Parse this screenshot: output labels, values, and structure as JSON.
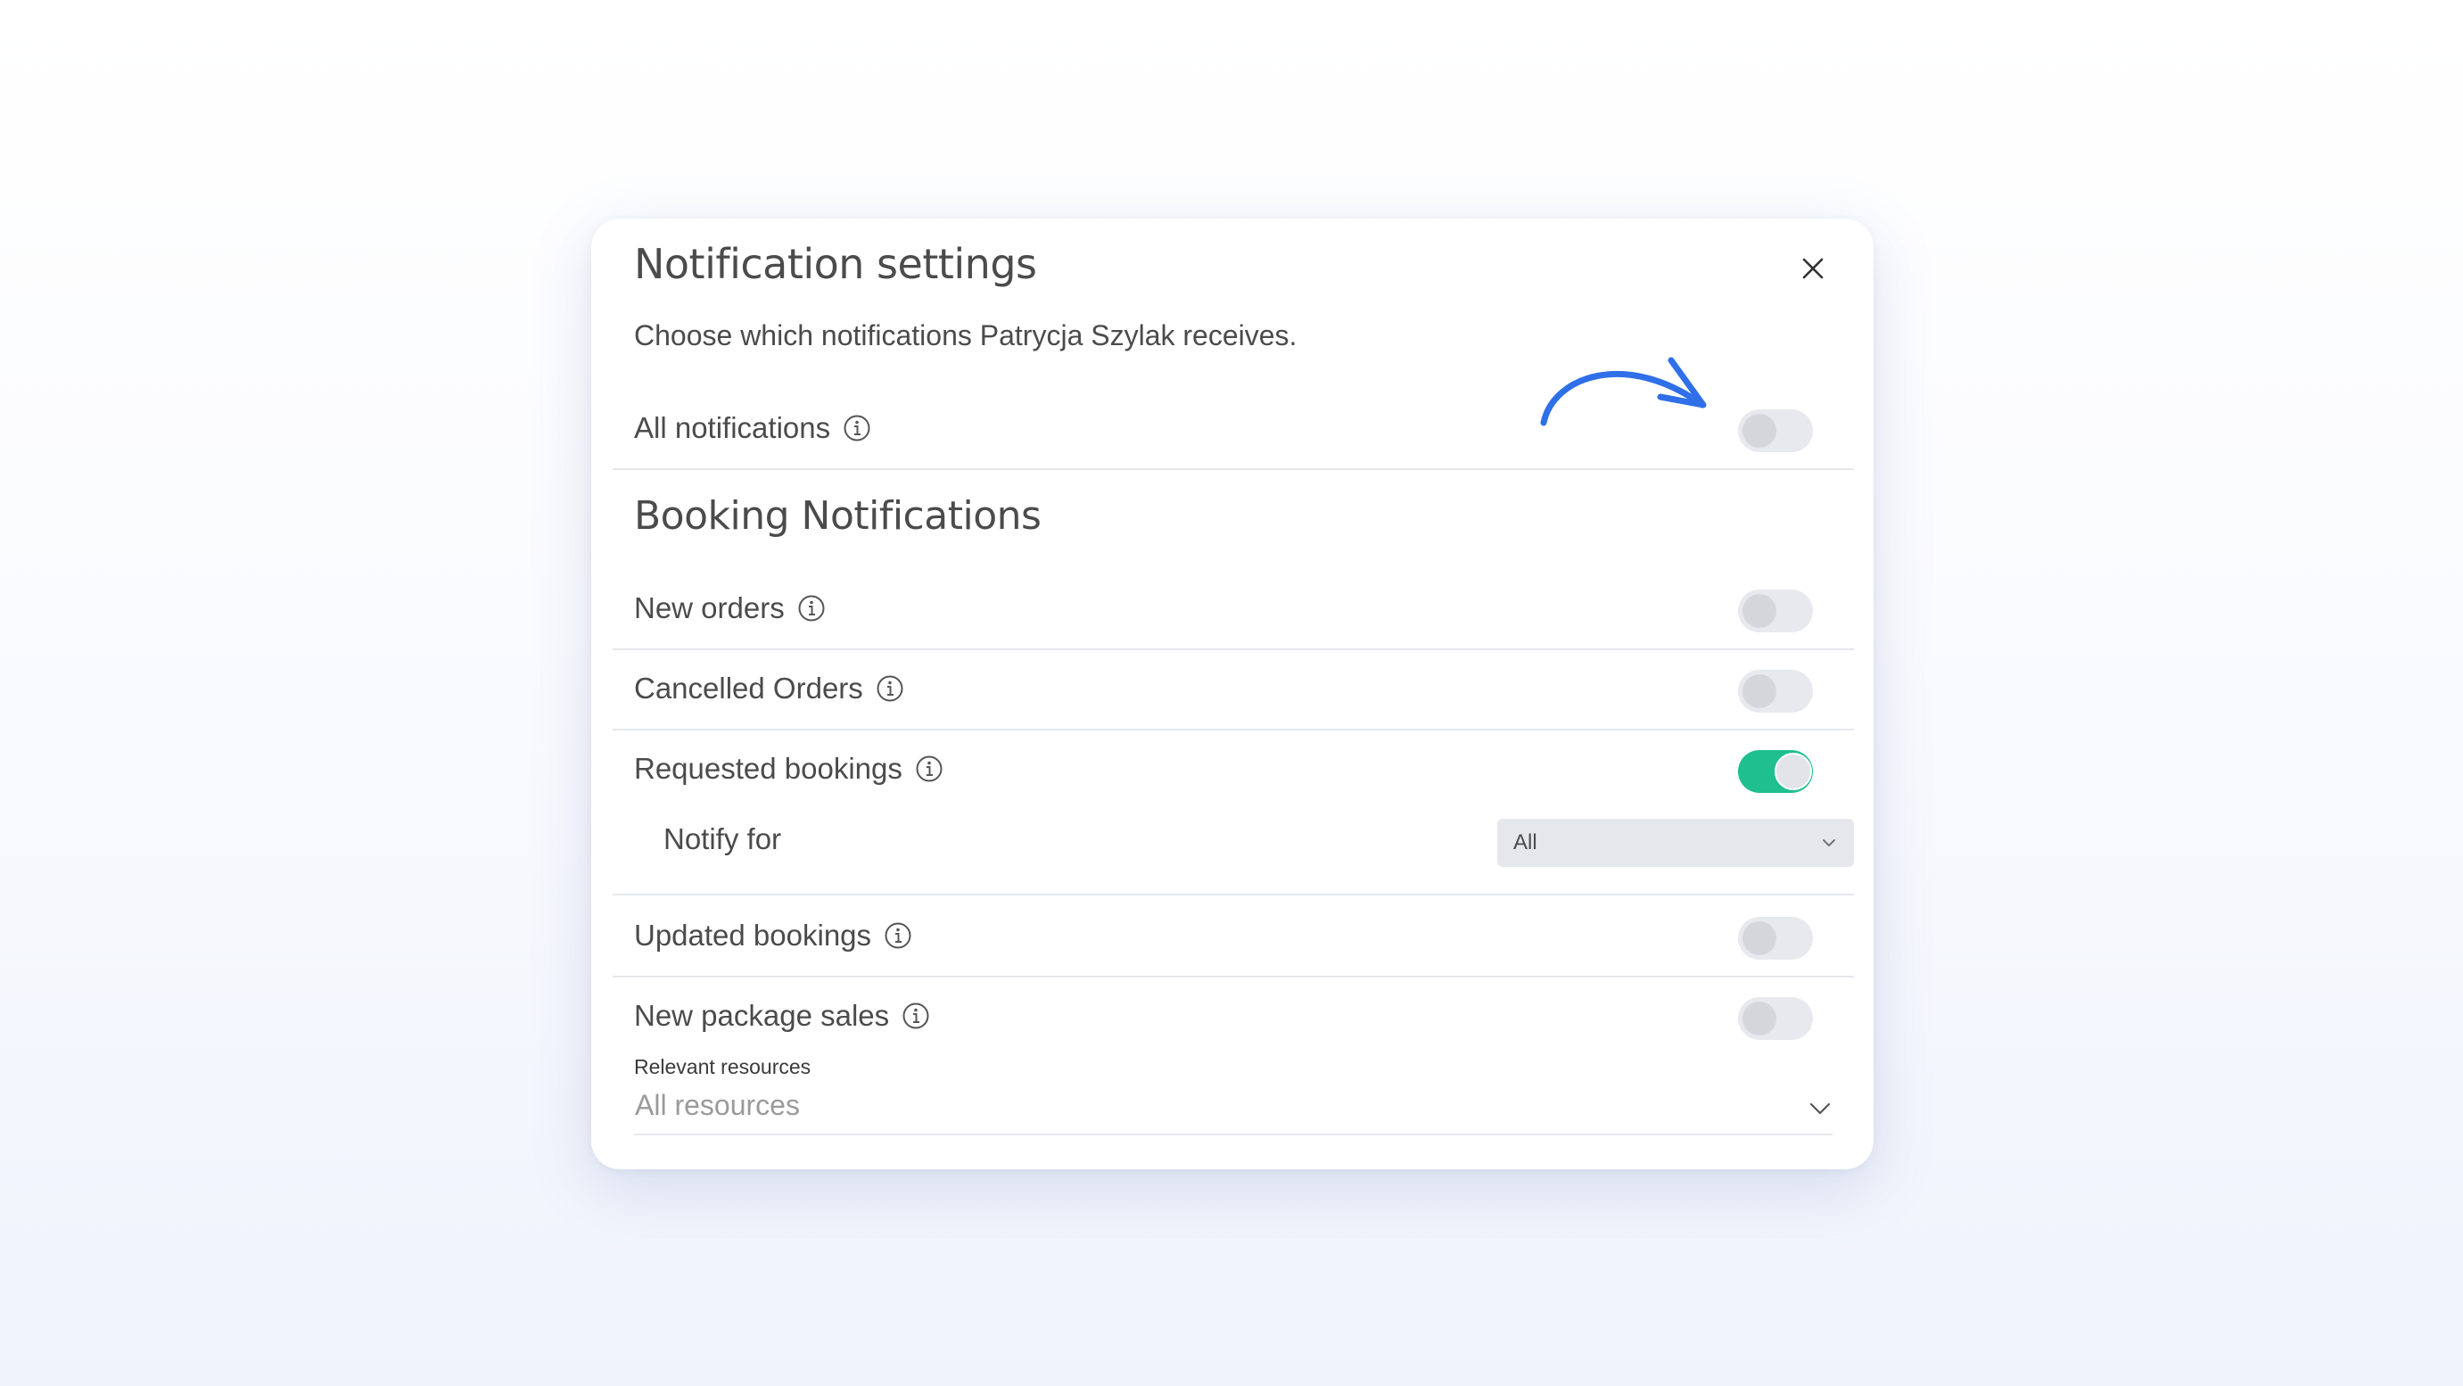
{
  "modal": {
    "title": "Notification settings",
    "subtitle": "Choose which notifications Patrycja Szylak receives.",
    "close_icon": "close-icon"
  },
  "all_notifications": {
    "label": "All notifications",
    "enabled": false
  },
  "booking": {
    "section_title": "Booking Notifications",
    "items": [
      {
        "label": "New orders",
        "enabled": false
      },
      {
        "label": "Cancelled Orders",
        "enabled": false
      },
      {
        "label": "Requested bookings",
        "enabled": true
      },
      {
        "label": "Updated bookings",
        "enabled": false
      },
      {
        "label": "New package sales",
        "enabled": false
      }
    ],
    "notify_for": {
      "label": "Notify for",
      "selected": "All"
    }
  },
  "resources": {
    "label": "Relevant resources",
    "placeholder": "All resources"
  },
  "colors": {
    "toggle_on": "#1fbf8f",
    "toggle_off": "#e8e9ee",
    "annotation_arrow": "#2f6fe8",
    "text": "#4b4b4b"
  },
  "icons": {
    "info": "info-icon",
    "chevron": "chevron-down-icon",
    "annotation": "curved-arrow-icon"
  }
}
